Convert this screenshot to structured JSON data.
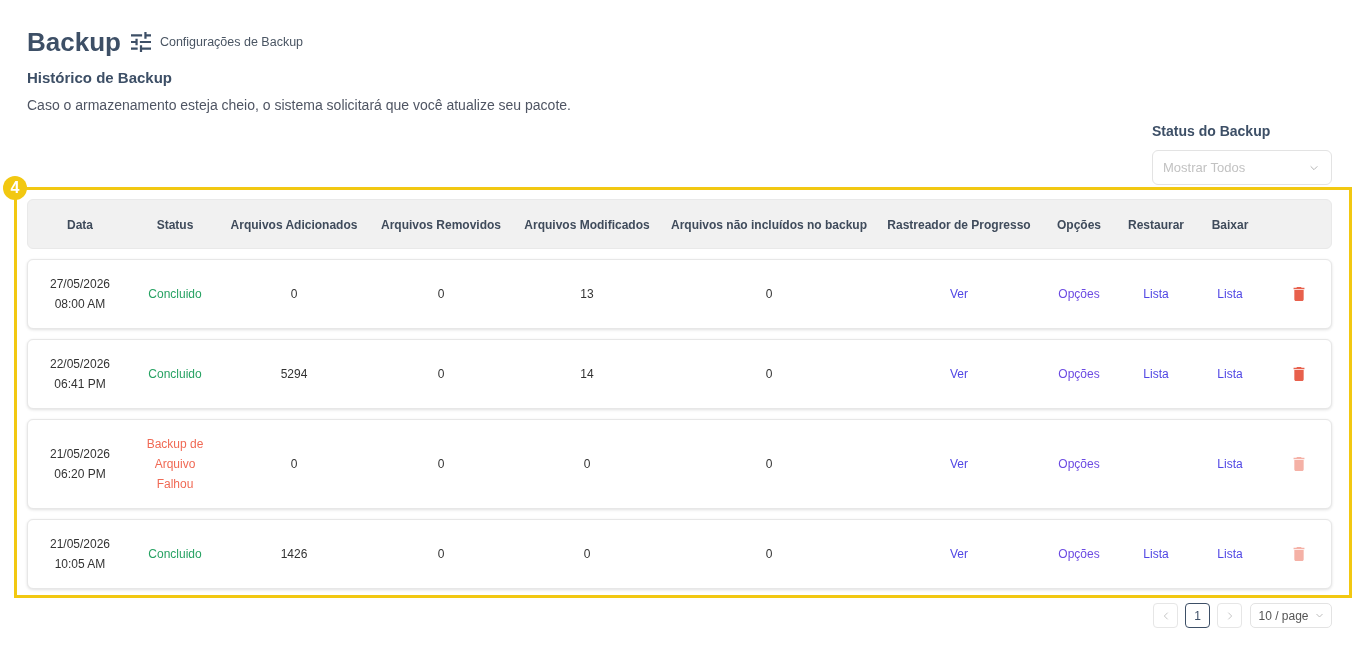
{
  "header": {
    "title": "Backup",
    "settings_link": "Configurações de Backup"
  },
  "section": {
    "title": "Histórico de Backup",
    "description": "Caso o armazenamento esteja cheio, o sistema solicitará que você atualize seu pacote."
  },
  "filter": {
    "label": "Status do Backup",
    "placeholder": "Mostrar Todos"
  },
  "highlight": {
    "step": "4"
  },
  "table": {
    "columns": [
      "Data",
      "Status",
      "Arquivos Adicionados",
      "Arquivos Removidos",
      "Arquivos Modificados",
      "Arquivos não incluídos no backup",
      "Rastreador de Progresso",
      "Opções",
      "Restaurar",
      "Baixar"
    ],
    "rows": [
      {
        "date": "27/05/2026",
        "time": "08:00 AM",
        "status": {
          "text": "Concluido",
          "kind": "success"
        },
        "added": "0",
        "removed": "0",
        "modified": "13",
        "excluded": "0",
        "progress": "Ver",
        "options": "Opções",
        "restore": "Lista",
        "download": "Lista",
        "delete_disabled": false
      },
      {
        "date": "22/05/2026",
        "time": "06:41 PM",
        "status": {
          "text": "Concluido",
          "kind": "success"
        },
        "added": "5294",
        "removed": "0",
        "modified": "14",
        "excluded": "0",
        "progress": "Ver",
        "options": "Opções",
        "restore": "Lista",
        "download": "Lista",
        "delete_disabled": false
      },
      {
        "date": "21/05/2026",
        "time": "06:20 PM",
        "status": {
          "text": "Backup de Arquivo Falhou",
          "kind": "failed"
        },
        "added": "0",
        "removed": "0",
        "modified": "0",
        "excluded": "0",
        "progress": "Ver",
        "options": "Opções",
        "download": "Lista",
        "delete_disabled": true
      },
      {
        "date": "21/05/2026",
        "time": "10:05 AM",
        "status": {
          "text": "Concluido",
          "kind": "success"
        },
        "added": "1426",
        "removed": "0",
        "modified": "0",
        "excluded": "0",
        "progress": "Ver",
        "options": "Opções",
        "restore": "Lista",
        "download": "Lista",
        "delete_disabled": true
      }
    ]
  },
  "pagination": {
    "previous_disabled": true,
    "pages": [
      {
        "label": "1",
        "selected": true
      }
    ],
    "next_disabled": true,
    "page_size": "10 / page"
  }
}
